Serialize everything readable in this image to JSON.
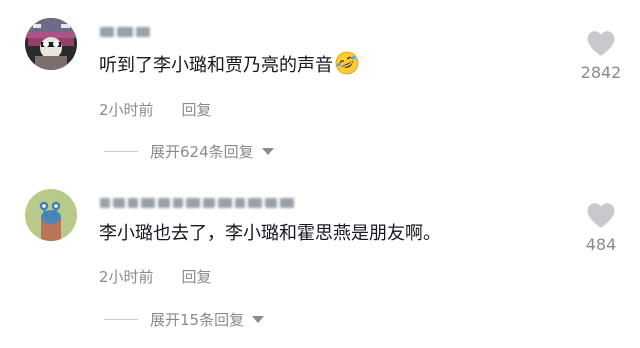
{
  "comments": [
    {
      "text": "听到了李小璐和贾乃亮的声音",
      "emoji": "rolling-on-floor-laughing-emoji",
      "time": "2小时前",
      "reply_label": "回复",
      "likes": "2842",
      "expand_label": "展开624条回复"
    },
    {
      "text": "李小璐也去了，李小璐和霍思燕是朋友啊。",
      "time": "2小时前",
      "reply_label": "回复",
      "likes": "484",
      "expand_label": "展开15条回复"
    }
  ],
  "colors": {
    "text": "#161823",
    "meta": "#8a8b91",
    "heart": "#c8c9cc"
  }
}
